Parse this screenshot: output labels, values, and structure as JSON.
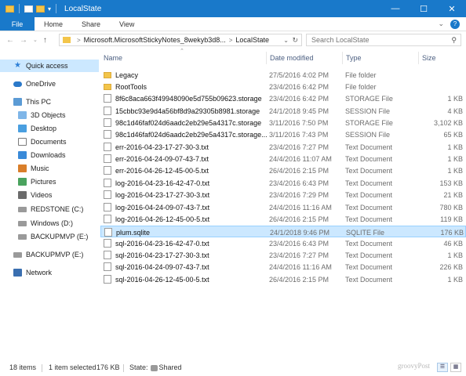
{
  "window": {
    "title": "LocalState"
  },
  "ribbon": {
    "tabs": [
      "File",
      "Home",
      "Share",
      "View"
    ]
  },
  "address": {
    "crumbs": [
      "Microsoft.MicrosoftStickyNotes_8wekyb3d8...",
      "LocalState"
    ],
    "search_placeholder": "Search LocalState"
  },
  "nav_pane": {
    "items": [
      {
        "label": "Quick access",
        "icon": "star-icon"
      },
      {
        "label": "OneDrive",
        "icon": "cloud-icon"
      },
      {
        "label": "This PC",
        "icon": "computer-icon"
      },
      {
        "label": "3D Objects",
        "icon": "cube-icon"
      },
      {
        "label": "Desktop",
        "icon": "desktop-icon"
      },
      {
        "label": "Documents",
        "icon": "documents-icon"
      },
      {
        "label": "Downloads",
        "icon": "downloads-icon"
      },
      {
        "label": "Music",
        "icon": "music-icon"
      },
      {
        "label": "Pictures",
        "icon": "pictures-icon"
      },
      {
        "label": "Videos",
        "icon": "videos-icon"
      },
      {
        "label": "REDSTONE (C:)",
        "icon": "drive-icon"
      },
      {
        "label": "Windows (D:)",
        "icon": "drive-icon"
      },
      {
        "label": "BACKUPMVP (E:)",
        "icon": "drive-icon"
      },
      {
        "label": "BACKUPMVP (E:)",
        "icon": "drive-icon"
      },
      {
        "label": "Network",
        "icon": "network-icon"
      }
    ]
  },
  "columns": [
    "Name",
    "Date modified",
    "Type",
    "Size"
  ],
  "files": [
    {
      "name": "Legacy",
      "date": "27/5/2016 4:02 PM",
      "type": "File folder",
      "size": "",
      "kind": "folder"
    },
    {
      "name": "RootTools",
      "date": "23/4/2016 6:42 PM",
      "type": "File folder",
      "size": "",
      "kind": "folder"
    },
    {
      "name": "8f6c8aca663f49948090e5d755b09623.storage",
      "date": "23/4/2016 6:42 PM",
      "type": "STORAGE File",
      "size": "1 KB",
      "kind": "file"
    },
    {
      "name": "15cbbc93e9d4a56bf8d9a29305b8981.storage",
      "date": "24/1/2018 9:45 PM",
      "type": "SESSION File",
      "size": "4 KB",
      "kind": "file"
    },
    {
      "name": "98c1d46faf024d6aadc2eb29e5a4317c.storage",
      "date": "3/11/2016 7:50 PM",
      "type": "STORAGE File",
      "size": "3,102 KB",
      "kind": "file"
    },
    {
      "name": "98c1d46faf024d6aadc2eb29e5a4317c.storage....",
      "date": "3/11/2016 7:43 PM",
      "type": "SESSION File",
      "size": "65 KB",
      "kind": "file"
    },
    {
      "name": "err-2016-04-23-17-27-30-3.txt",
      "date": "23/4/2016 7:27 PM",
      "type": "Text Document",
      "size": "1 KB",
      "kind": "file"
    },
    {
      "name": "err-2016-04-24-09-07-43-7.txt",
      "date": "24/4/2016 11:07 AM",
      "type": "Text Document",
      "size": "1 KB",
      "kind": "file"
    },
    {
      "name": "err-2016-04-26-12-45-00-5.txt",
      "date": "26/4/2016 2:15 PM",
      "type": "Text Document",
      "size": "1 KB",
      "kind": "file"
    },
    {
      "name": "log-2016-04-23-16-42-47-0.txt",
      "date": "23/4/2016 6:43 PM",
      "type": "Text Document",
      "size": "153 KB",
      "kind": "file"
    },
    {
      "name": "log-2016-04-23-17-27-30-3.txt",
      "date": "23/4/2016 7:29 PM",
      "type": "Text Document",
      "size": "21 KB",
      "kind": "file"
    },
    {
      "name": "log-2016-04-24-09-07-43-7.txt",
      "date": "24/4/2016 11:16 AM",
      "type": "Text Document",
      "size": "780 KB",
      "kind": "file"
    },
    {
      "name": "log-2016-04-26-12-45-00-5.txt",
      "date": "26/4/2016 2:15 PM",
      "type": "Text Document",
      "size": "119 KB",
      "kind": "file"
    },
    {
      "name": "plum.sqlite",
      "date": "24/1/2018 9:46 PM",
      "type": "SQLITE File",
      "size": "176 KB",
      "kind": "file",
      "selected": true
    },
    {
      "name": "sql-2016-04-23-16-42-47-0.txt",
      "date": "23/4/2016 6:43 PM",
      "type": "Text Document",
      "size": "46 KB",
      "kind": "file"
    },
    {
      "name": "sql-2016-04-23-17-27-30-3.txt",
      "date": "23/4/2016 7:27 PM",
      "type": "Text Document",
      "size": "1 KB",
      "kind": "file"
    },
    {
      "name": "sql-2016-04-24-09-07-43-7.txt",
      "date": "24/4/2016 11:16 AM",
      "type": "Text Document",
      "size": "226 KB",
      "kind": "file"
    },
    {
      "name": "sql-2016-04-26-12-45-00-5.txt",
      "date": "26/4/2016 2:15 PM",
      "type": "Text Document",
      "size": "1 KB",
      "kind": "file"
    }
  ],
  "status": {
    "items": "18 items",
    "selected": "1 item selected",
    "size": "176 KB",
    "state_label": "State:",
    "state_value": "Shared"
  },
  "watermark": "groovyPost",
  "colors": {
    "accent": "#1979ca",
    "selection": "#cce8ff"
  }
}
